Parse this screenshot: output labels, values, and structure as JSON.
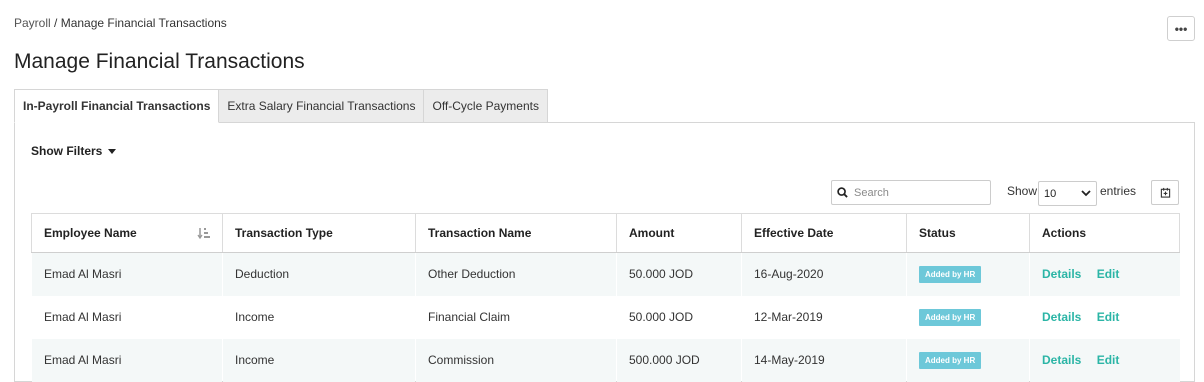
{
  "breadcrumb": {
    "parent": "Payroll",
    "separator": " / ",
    "current": "Manage Financial Transactions"
  },
  "header": {
    "more_label": "•••",
    "title": "Manage Financial Transactions"
  },
  "tabs": [
    {
      "label": "In-Payroll Financial Transactions",
      "active": true
    },
    {
      "label": "Extra Salary Financial Transactions",
      "active": false
    },
    {
      "label": "Off-Cycle Payments",
      "active": false
    }
  ],
  "filters": {
    "toggle_label": "Show Filters"
  },
  "toolbar": {
    "search_placeholder": "Search",
    "search_value": "",
    "show_label": "Show",
    "entries_value": "10",
    "entries_label": "entries",
    "icons": {
      "search": "search-icon",
      "dropdown": "chevron-down-icon",
      "export": "export-icon",
      "sort": "sort-icon"
    }
  },
  "table": {
    "columns": [
      "Employee Name",
      "Transaction Type",
      "Transaction Name",
      "Amount",
      "Effective Date",
      "Status",
      "Actions"
    ],
    "rows": [
      {
        "employee": "Emad Al Masri",
        "type": "Deduction",
        "name": "Other Deduction",
        "amount": "50.000 JOD",
        "date": "16-Aug-2020",
        "status": "Added by HR",
        "action_details": "Details",
        "action_edit": "Edit"
      },
      {
        "employee": "Emad Al Masri",
        "type": "Income",
        "name": "Financial Claim",
        "amount": "50.000 JOD",
        "date": "12-Mar-2019",
        "status": "Added by HR",
        "action_details": "Details",
        "action_edit": "Edit"
      },
      {
        "employee": "Emad Al Masri",
        "type": "Income",
        "name": "Commission",
        "amount": "500.000 JOD",
        "date": "14-May-2019",
        "status": "Added by HR",
        "action_details": "Details",
        "action_edit": "Edit"
      }
    ]
  },
  "colors": {
    "accent_link": "#2bb5a6",
    "badge_bg": "#6dc8d9",
    "row_stripe": "#f4f8f8",
    "tab_inactive_bg": "#ececec"
  }
}
